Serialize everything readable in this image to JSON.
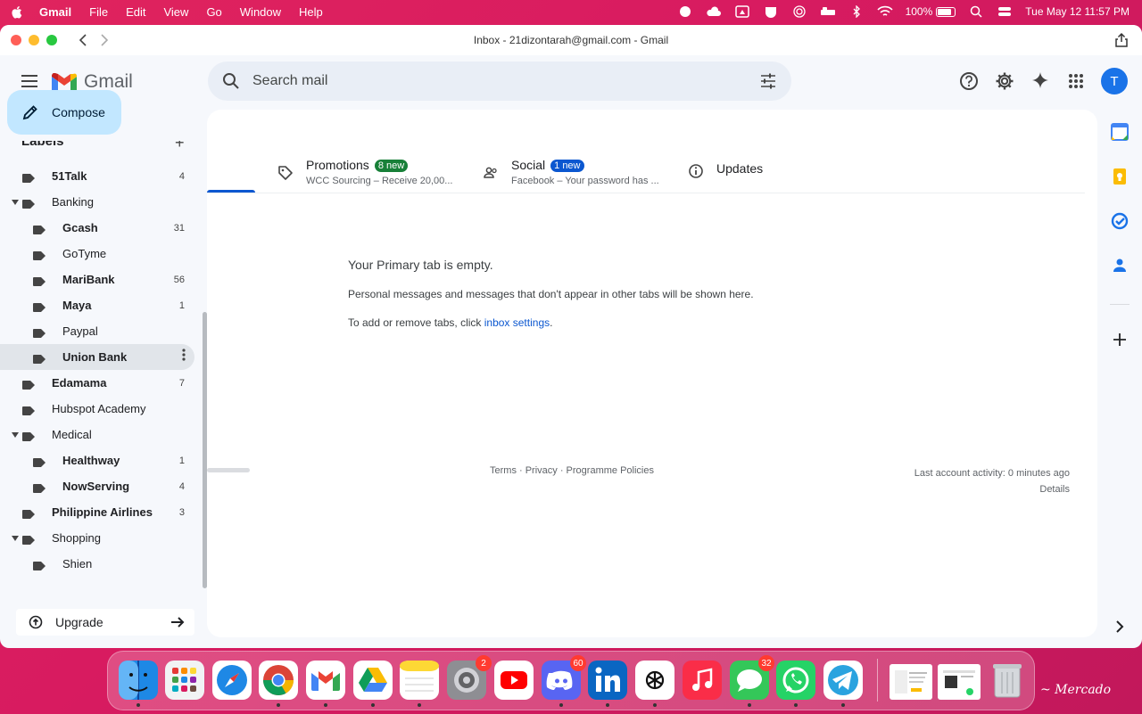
{
  "menubar": {
    "app_name": "Gmail",
    "items": [
      "File",
      "Edit",
      "View",
      "Go",
      "Window",
      "Help"
    ],
    "battery": "100%",
    "datetime": "Tue May 12  11:57 PM"
  },
  "window": {
    "title": "Inbox - 21dizontarah@gmail.com - Gmail"
  },
  "header": {
    "logo_text": "Gmail",
    "search_placeholder": "Search mail",
    "avatar_letter": "T"
  },
  "compose_label": "Compose",
  "sidebar": {
    "labels_heading": "Labels",
    "labels_add": "+",
    "items": [
      {
        "name": "51Talk",
        "count": "4",
        "bold": true,
        "level": 0,
        "caret": false
      },
      {
        "name": "Banking",
        "count": "",
        "bold": false,
        "level": 0,
        "caret": true
      },
      {
        "name": "Gcash",
        "count": "31",
        "bold": true,
        "level": 1,
        "caret": false
      },
      {
        "name": "GoTyme",
        "count": "",
        "bold": false,
        "level": 1,
        "caret": false
      },
      {
        "name": "MariBank",
        "count": "56",
        "bold": true,
        "level": 1,
        "caret": false
      },
      {
        "name": "Maya",
        "count": "1",
        "bold": true,
        "level": 1,
        "caret": false
      },
      {
        "name": "Paypal",
        "count": "",
        "bold": false,
        "level": 1,
        "caret": false
      },
      {
        "name": "Union Bank",
        "count": "",
        "bold": true,
        "level": 1,
        "caret": false,
        "selected": true
      },
      {
        "name": "Edamama",
        "count": "7",
        "bold": true,
        "level": 0,
        "caret": false
      },
      {
        "name": "Hubspot Academy",
        "count": "",
        "bold": false,
        "level": 0,
        "caret": false
      },
      {
        "name": "Medical",
        "count": "",
        "bold": false,
        "level": 0,
        "caret": true
      },
      {
        "name": "Healthway",
        "count": "1",
        "bold": true,
        "level": 1,
        "caret": false
      },
      {
        "name": "NowServing",
        "count": "4",
        "bold": true,
        "level": 1,
        "caret": false
      },
      {
        "name": "Philippine Airlines",
        "count": "3",
        "bold": true,
        "level": 0,
        "caret": false
      },
      {
        "name": "Shopping",
        "count": "",
        "bold": false,
        "level": 0,
        "caret": true
      },
      {
        "name": "Shien",
        "count": "",
        "bold": false,
        "level": 1,
        "caret": false
      }
    ],
    "upgrade_label": "Upgrade"
  },
  "tabs": [
    {
      "name": "Promotions",
      "badge": "8 new",
      "badge_color": "#188038",
      "subtitle": "WCC Sourcing – Receive 20,00..."
    },
    {
      "name": "Social",
      "badge": "1 new",
      "badge_color": "#0b57d0",
      "subtitle": "Facebook – Your password has ..."
    },
    {
      "name": "Updates",
      "badge": "",
      "badge_color": "",
      "subtitle": ""
    }
  ],
  "empty": {
    "title": "Your Primary tab is empty.",
    "description": "Personal messages and messages that don't appear in other tabs will be shown here.",
    "hint_prefix": "To add or remove tabs, click ",
    "hint_link": "inbox settings",
    "hint_suffix": "."
  },
  "footer": {
    "links": "Terms · Privacy · Programme Policies",
    "activity": "Last account activity: 0 minutes ago",
    "details": "Details"
  },
  "dock": {
    "apps": [
      {
        "name": "finder",
        "badge": ""
      },
      {
        "name": "launchpad",
        "badge": ""
      },
      {
        "name": "safari",
        "badge": ""
      },
      {
        "name": "chrome",
        "badge": ""
      },
      {
        "name": "gmail",
        "badge": ""
      },
      {
        "name": "google-drive",
        "badge": ""
      },
      {
        "name": "notes",
        "badge": ""
      },
      {
        "name": "system-settings",
        "badge": "2"
      },
      {
        "name": "youtube",
        "badge": ""
      },
      {
        "name": "discord",
        "badge": "60"
      },
      {
        "name": "linkedin",
        "badge": ""
      },
      {
        "name": "chatgpt",
        "badge": ""
      },
      {
        "name": "music",
        "badge": ""
      },
      {
        "name": "messages",
        "badge": "32"
      },
      {
        "name": "whatsapp",
        "badge": ""
      },
      {
        "name": "telegram",
        "badge": ""
      }
    ]
  },
  "colors": {
    "accent": "#0b57d0",
    "compose_bg": "#c2e7ff",
    "promotions_badge": "#188038",
    "social_badge": "#0b57d0",
    "desktop": "#d81b60"
  }
}
